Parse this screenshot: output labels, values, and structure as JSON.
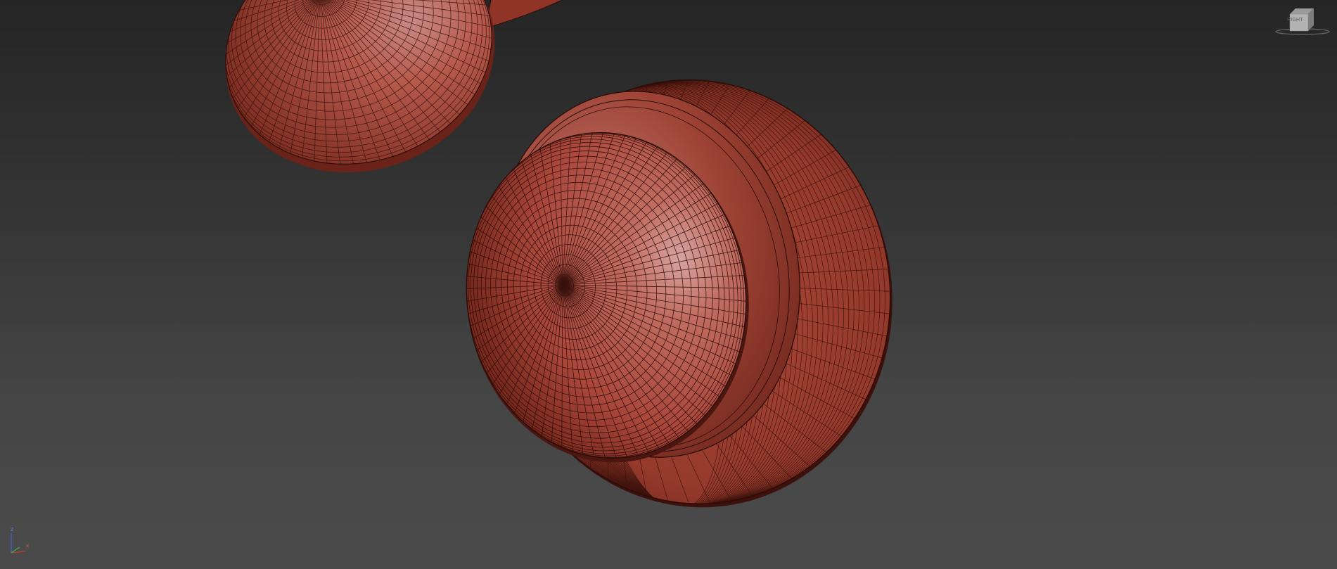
{
  "viewport": {
    "background_top": "#252525",
    "background_bottom": "#4b4b4b",
    "mesh_color": "#b24a3a",
    "wire_color": "#2a0d08"
  },
  "viewcube": {
    "icon": "viewcube-icon",
    "face_label": "RIGHT"
  },
  "axis_gizmo": {
    "icon": "axis-tripod-icon",
    "z_label": "z",
    "x_label": "x",
    "colors": {
      "x": "#c0392b",
      "y": "#3bb54a",
      "z": "#3f5fd0"
    }
  }
}
